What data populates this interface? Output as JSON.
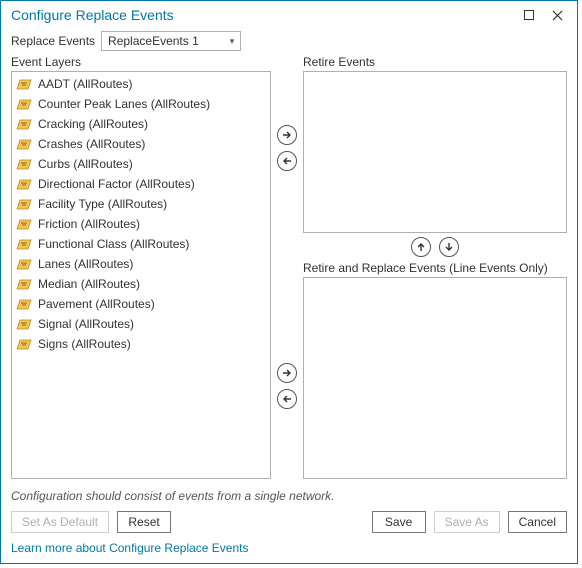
{
  "window": {
    "title": "Configure Replace Events"
  },
  "toolbar": {
    "replace_events_label": "Replace Events",
    "replace_events_value": "ReplaceEvents 1"
  },
  "panels": {
    "event_layers_header": "Event Layers",
    "retire_events_header": "Retire Events",
    "retire_replace_header": "Retire and Replace Events (Line Events Only)"
  },
  "event_layers": [
    "AADT (AllRoutes)",
    "Counter Peak Lanes (AllRoutes)",
    "Cracking (AllRoutes)",
    "Crashes (AllRoutes)",
    "Curbs (AllRoutes)",
    "Directional Factor (AllRoutes)",
    "Facility Type (AllRoutes)",
    "Friction (AllRoutes)",
    "Functional Class (AllRoutes)",
    "Lanes (AllRoutes)",
    "Median (AllRoutes)",
    "Pavement (AllRoutes)",
    "Signal (AllRoutes)",
    "Signs (AllRoutes)"
  ],
  "note": "Configuration should consist of events from a single network.",
  "buttons": {
    "set_default": "Set As Default",
    "reset": "Reset",
    "save": "Save",
    "save_as": "Save As",
    "cancel": "Cancel"
  },
  "link": "Learn more about Configure Replace Events"
}
